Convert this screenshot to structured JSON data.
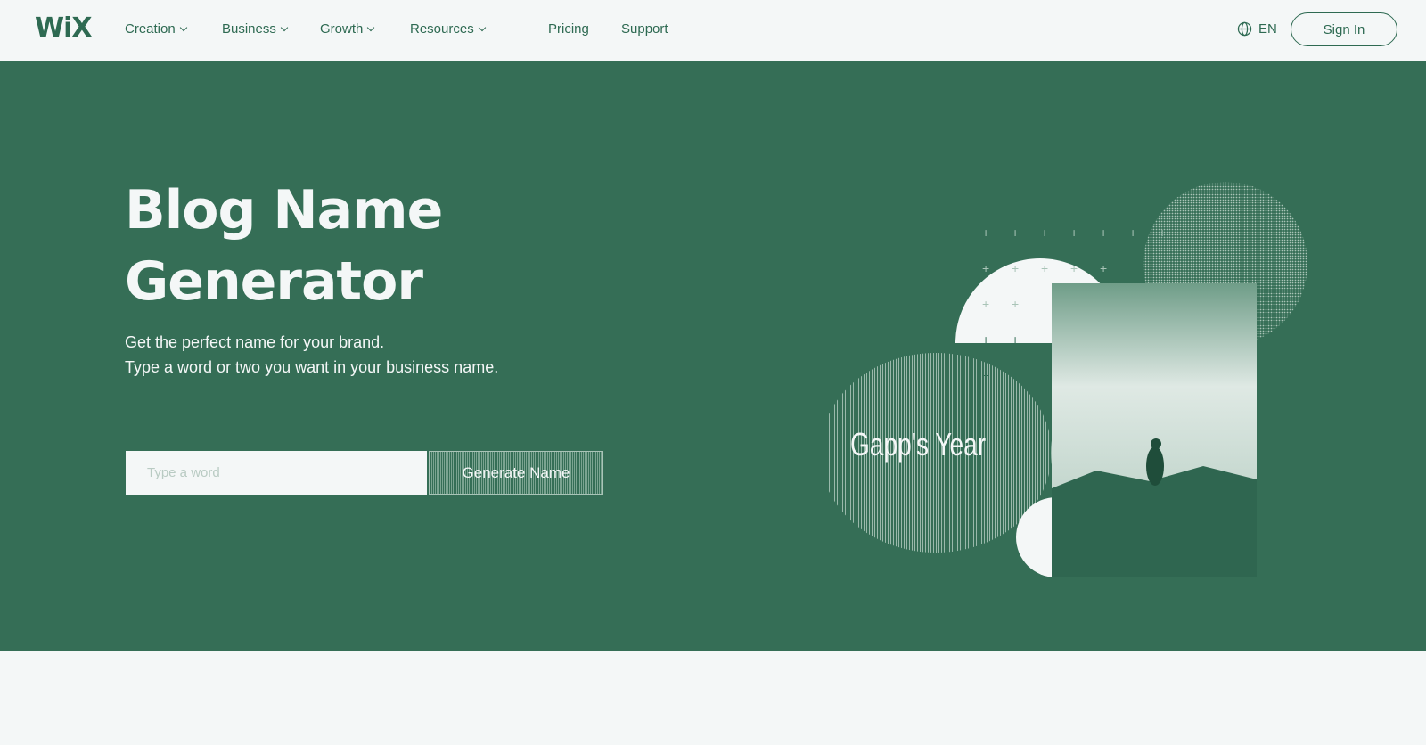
{
  "brand": {
    "logo": "WiX",
    "accent": "#356e56",
    "light": "#f4f7f7"
  },
  "nav": {
    "items": [
      {
        "label": "Creation",
        "dropdown": true
      },
      {
        "label": "Business",
        "dropdown": true
      },
      {
        "label": "Growth",
        "dropdown": true
      },
      {
        "label": "Resources",
        "dropdown": true
      },
      {
        "label": "Pricing",
        "dropdown": false
      },
      {
        "label": "Support",
        "dropdown": false
      }
    ],
    "language": "EN",
    "language_icon": "globe-icon",
    "sign_in": "Sign In"
  },
  "hero": {
    "title_line1": "Blog Name",
    "title_line2": "Generator",
    "subtitle_line1": "Get the perfect name for your brand.",
    "subtitle_line2": "Type a word or two you want in your business name.",
    "input_placeholder": "Type a word",
    "button_label": "Generate Name",
    "illustration_caption": "Gapp's Year"
  }
}
